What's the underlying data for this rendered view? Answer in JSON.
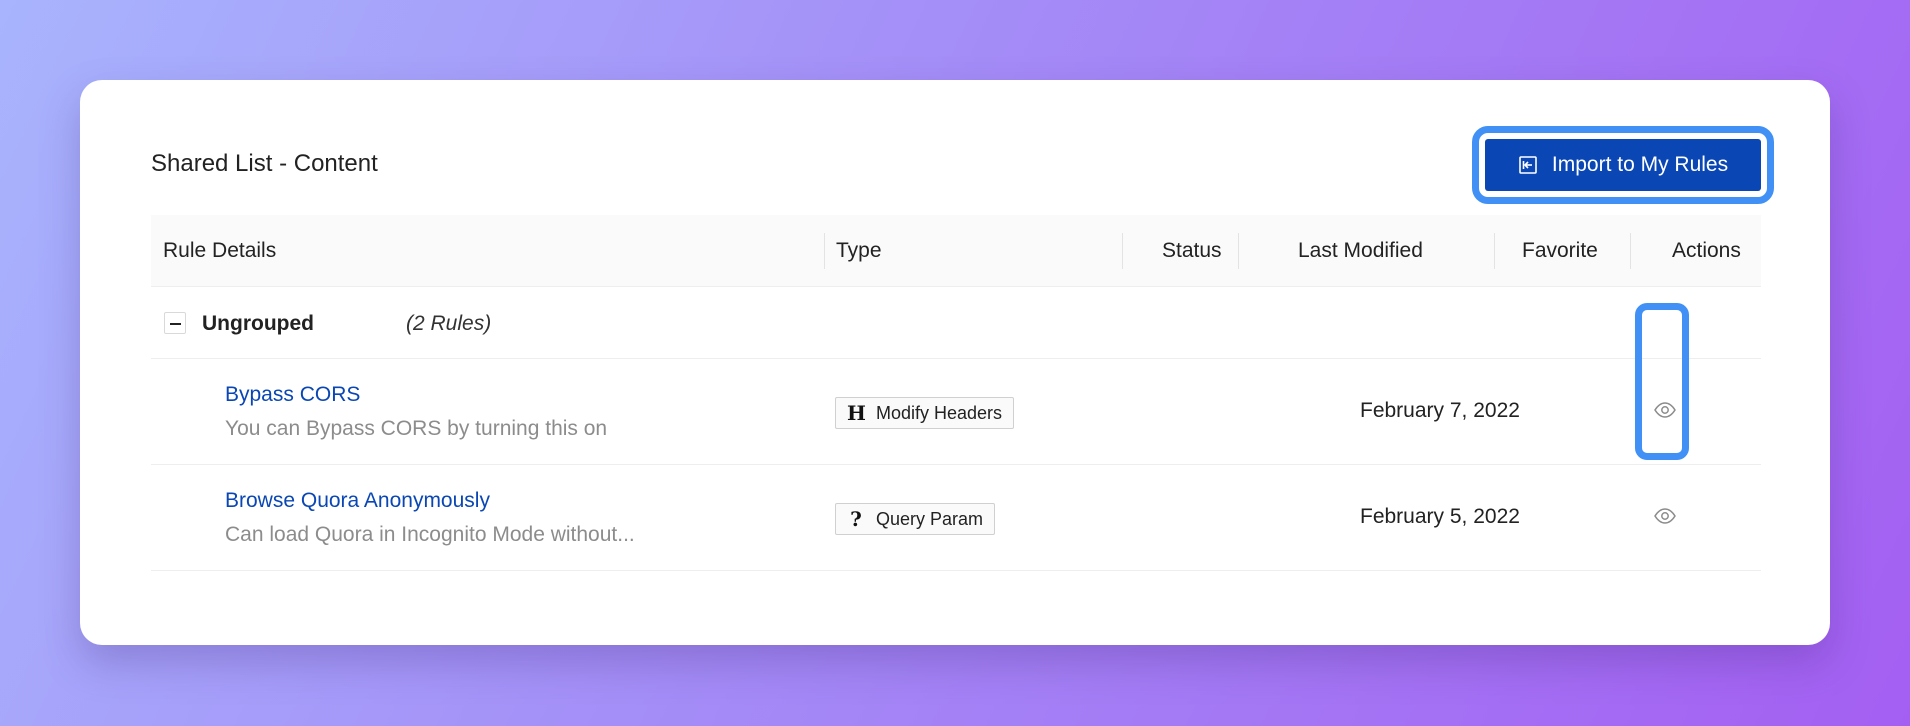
{
  "header": {
    "title": "Shared List - Content",
    "import_button_label": "Import to My Rules"
  },
  "table": {
    "columns": [
      "Rule Details",
      "Type",
      "Status",
      "Last Modified",
      "Favorite",
      "Actions"
    ],
    "group": {
      "name": "Ungrouped",
      "count_label": "(2 Rules)"
    },
    "rows": [
      {
        "name": "Bypass CORS",
        "description": "You can Bypass CORS by turning this on",
        "type_icon": "H",
        "type_icon_name": "modify-headers-icon",
        "type": "Modify Headers",
        "last_modified": "February 7, 2022"
      },
      {
        "name": "Browse Quora Anonymously",
        "description": "Can load Quora in Incognito Mode without...",
        "type_icon": "?",
        "type_icon_name": "query-param-icon",
        "type": "Query Param",
        "last_modified": "February 5, 2022"
      }
    ]
  },
  "colors": {
    "primary": "#0a47b4",
    "highlight": "#4090f5",
    "link": "#0a47b4",
    "muted_text": "#8c8c8c"
  }
}
